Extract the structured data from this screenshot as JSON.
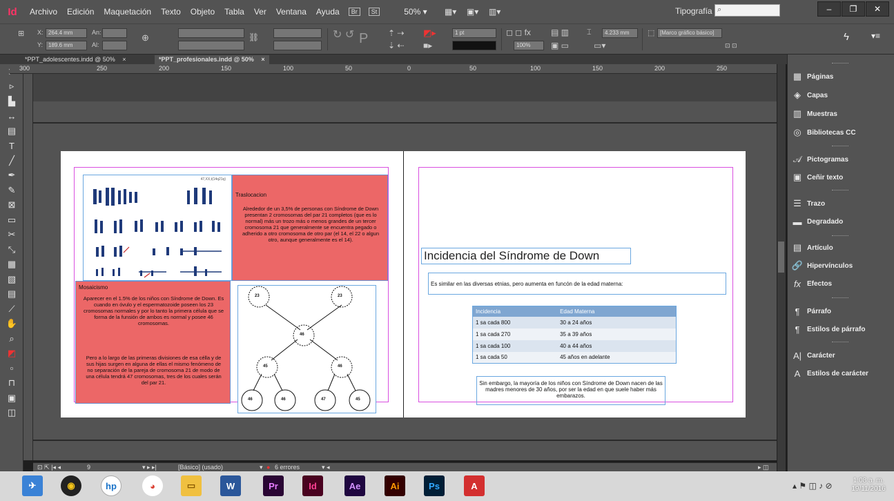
{
  "app": {
    "logo": "Id"
  },
  "menu": [
    "Archivo",
    "Edición",
    "Maquetación",
    "Texto",
    "Objeto",
    "Tabla",
    "Ver",
    "Ventana",
    "Ayuda"
  ],
  "menu_badges": [
    "Br",
    "St"
  ],
  "zoom": "50%",
  "workspace": "Tipografía",
  "control": {
    "x_label": "X:",
    "x_value": "264.4 mm",
    "y_label": "Y:",
    "y_value": "189.6 mm",
    "w_label": "An:",
    "h_label": "Al:",
    "stroke_weight": "1 pt",
    "opacity": "100%",
    "spacing": "4.233 mm",
    "frame_style": "[Marco gráfico básico]"
  },
  "tabs": [
    {
      "label": "*PPT_adolescentes.indd @ 50%",
      "close": "×"
    },
    {
      "label": "*PPT_profesionales.indd @ 50%",
      "close": "×"
    }
  ],
  "ruler_labels": [
    "300",
    "250",
    "200",
    "150",
    "100",
    "50",
    "0",
    "50",
    "100",
    "150",
    "200",
    "250",
    "3"
  ],
  "panels": [
    "Páginas",
    "Capas",
    "Muestras",
    "Bibliotecas CC",
    "Pictogramas",
    "Ceñir texto",
    "Trazo",
    "Degradado",
    "Artículo",
    "Hipervínculos",
    "Efectos",
    "Párrafo",
    "Estilos de párrafo",
    "Carácter",
    "Estilos de carácter"
  ],
  "panel_icons": [
    "pages-icon",
    "layers-icon",
    "swatches-icon",
    "cc-libraries-icon",
    "glyphs-icon",
    "text-wrap-icon",
    "stroke-icon",
    "gradient-icon",
    "articles-icon",
    "hyperlinks-icon",
    "effects-icon",
    "paragraph-icon",
    "paragraph-styles-icon",
    "character-icon",
    "character-styles-icon"
  ],
  "status": {
    "page": "9",
    "preflight_style": "[Básico] (usado)",
    "errors": "6 errores"
  },
  "page": {
    "chrom_caption": "47,XX,t(14q21q)",
    "traslocacion_title": "Traslocacion",
    "traslocacion_body": "Alrededor de un 3,5% de personas con Síndrome de Down presentan 2 cromosomas del par 21 completos (que es lo normal) más un trozo más o menos grandes de un tercer cromosoma 21 que generalmente se encuentra pegado o adherido a otro cromosoma de otro par (el 14, el 22 o algun otro, aunque generalmente es el 14).",
    "mosaicismo_title": "Mosaicismo",
    "mosaicismo_p1": "Aparecer en el 1.5% de los niños con Síndrome de Down. Es cuando en óvulo y el espermatozoide poseen los 23 cromosomas normales y por lo tanto la primera célula que se forma de la funsión de ambos es normal y posee 46 cromosomas.",
    "mosaicismo_p2": "Pero a lo largo de las primeras divisiones de esa célla y de sus hijas surgen en alguna de ellas el mismo fenómeno de no separación de la pareja de cromosoma 21 de modo de una célula tendrá 47 cromosomas, tres de los cuales serán del par 21.",
    "tree_nodes": {
      "top_left": "23",
      "top_right": "23",
      "middle": "46",
      "left": "45",
      "right": "46",
      "leaf_1": "46",
      "leaf_2": "46",
      "leaf_3": "47",
      "leaf_4": "45"
    },
    "title": "Incidencia del Síndrome de Down",
    "intro": "Es similar en las diversas etnias, pero aumenta en funcón de la edad materna:",
    "table_headers": [
      "Incidencia",
      "Edad Materna"
    ],
    "table_rows": [
      [
        "1 sa cada 800",
        "30 a 24 años"
      ],
      [
        "1 sa cada 270",
        "35 a 39 años"
      ],
      [
        "1 sa cada 100",
        "40 a 44 años"
      ],
      [
        "1 sa cada 50",
        "45 años en adelante"
      ]
    ],
    "note": "Sin embargo, la mayoría de los niños con Síndrome de Down nacen de las madres menores de 30 años, por ser la edad en que suele haber más embarazos."
  },
  "taskbar": {
    "apps": [
      "W",
      "Pr",
      "Id",
      "Ae",
      "Ai",
      "Ps",
      "A"
    ],
    "time": "1:08 a. m.",
    "date": "19/11/2016"
  }
}
